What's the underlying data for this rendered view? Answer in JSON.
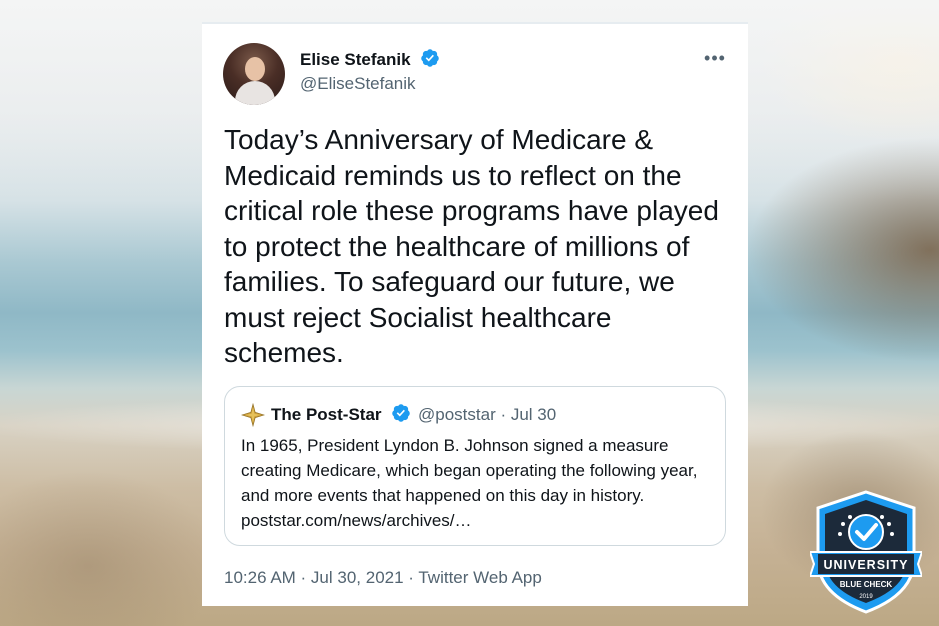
{
  "tweet": {
    "author": {
      "name": "Elise Stefanik",
      "handle": "@EliseStefanik",
      "verified": true
    },
    "more_label": "•••",
    "text": "Today’s Anniversary of Medicare & Medicaid reminds us to reflect on the critical role these programs have played to protect the healthcare of millions of families. To safeguard our future, we must reject Socialist healthcare schemes.",
    "quoted": {
      "name": "The Post-Star",
      "handle_date": "@poststar · Jul 30",
      "verified": true,
      "text": "In 1965, President Lyndon B. Johnson signed a measure creating Medicare, which began operating the following year, and more events that happened on this day in history. poststar.com/news/archives/…"
    },
    "timestamp": "10:26 AM · Jul 30, 2021 · Twitter Web App"
  },
  "badge": {
    "line1": "UNIVERSITY",
    "line2": "BLUE CHECK",
    "year": "2019"
  },
  "colors": {
    "verified_blue": "#1d9bf0",
    "text_primary": "#0f1419",
    "text_secondary": "#536471",
    "badge_dark": "#1c2a3a",
    "badge_blue": "#1d9bf0"
  }
}
